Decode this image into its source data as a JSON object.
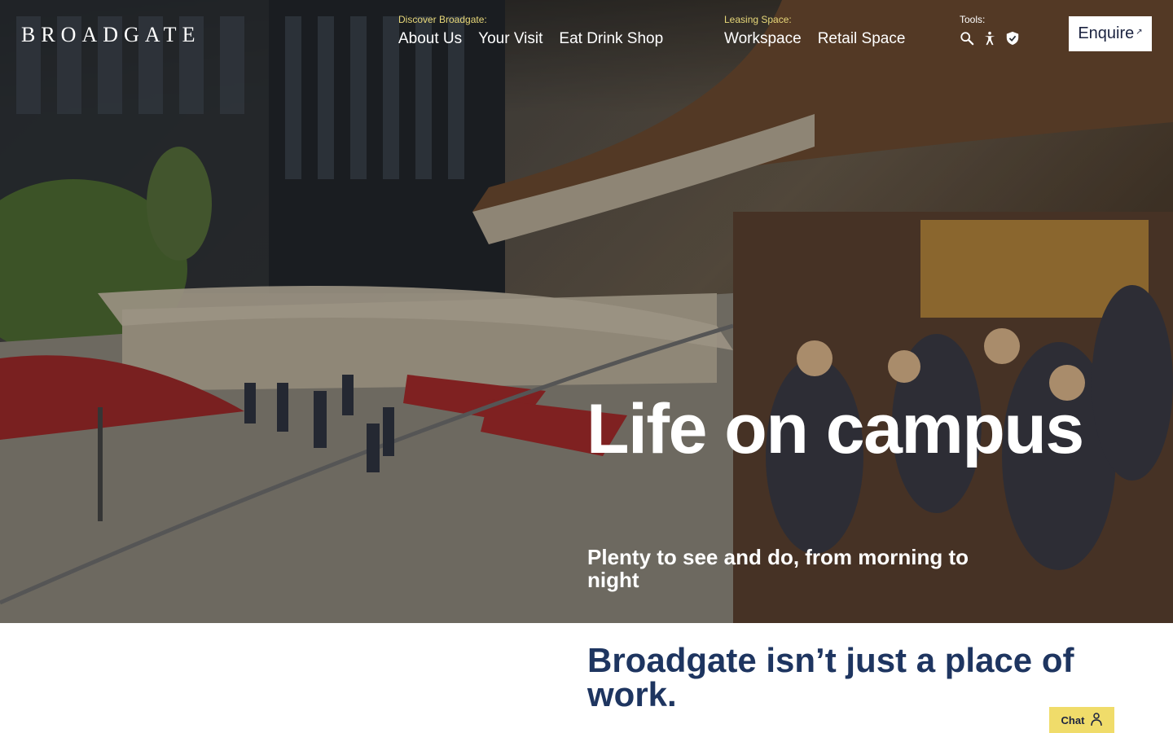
{
  "header": {
    "logo": "BROADGATE",
    "discover": {
      "caption": "Discover Broadgate:",
      "links": [
        "About Us",
        "Your Visit",
        "Eat Drink Shop"
      ]
    },
    "leasing": {
      "caption": "Leasing Space:",
      "links": [
        "Workspace",
        "Retail Space"
      ]
    },
    "tools": {
      "caption": "Tools:",
      "icons": [
        "search-icon",
        "accessibility-icon",
        "shield-check-icon"
      ]
    },
    "enquire_label": "Enquire",
    "enquire_icon": "external-link-icon"
  },
  "hero": {
    "title": "Life on campus",
    "subtitle": "Plenty to see and do, from morning to night"
  },
  "intro": {
    "heading": "Broadgate isn’t just a place of work."
  },
  "chat": {
    "label": "Chat",
    "icon": "person-icon"
  },
  "colors": {
    "accent_yellow": "#f0dc6a",
    "caption_yellow": "#e8d87a",
    "navy": "#1e3560"
  }
}
